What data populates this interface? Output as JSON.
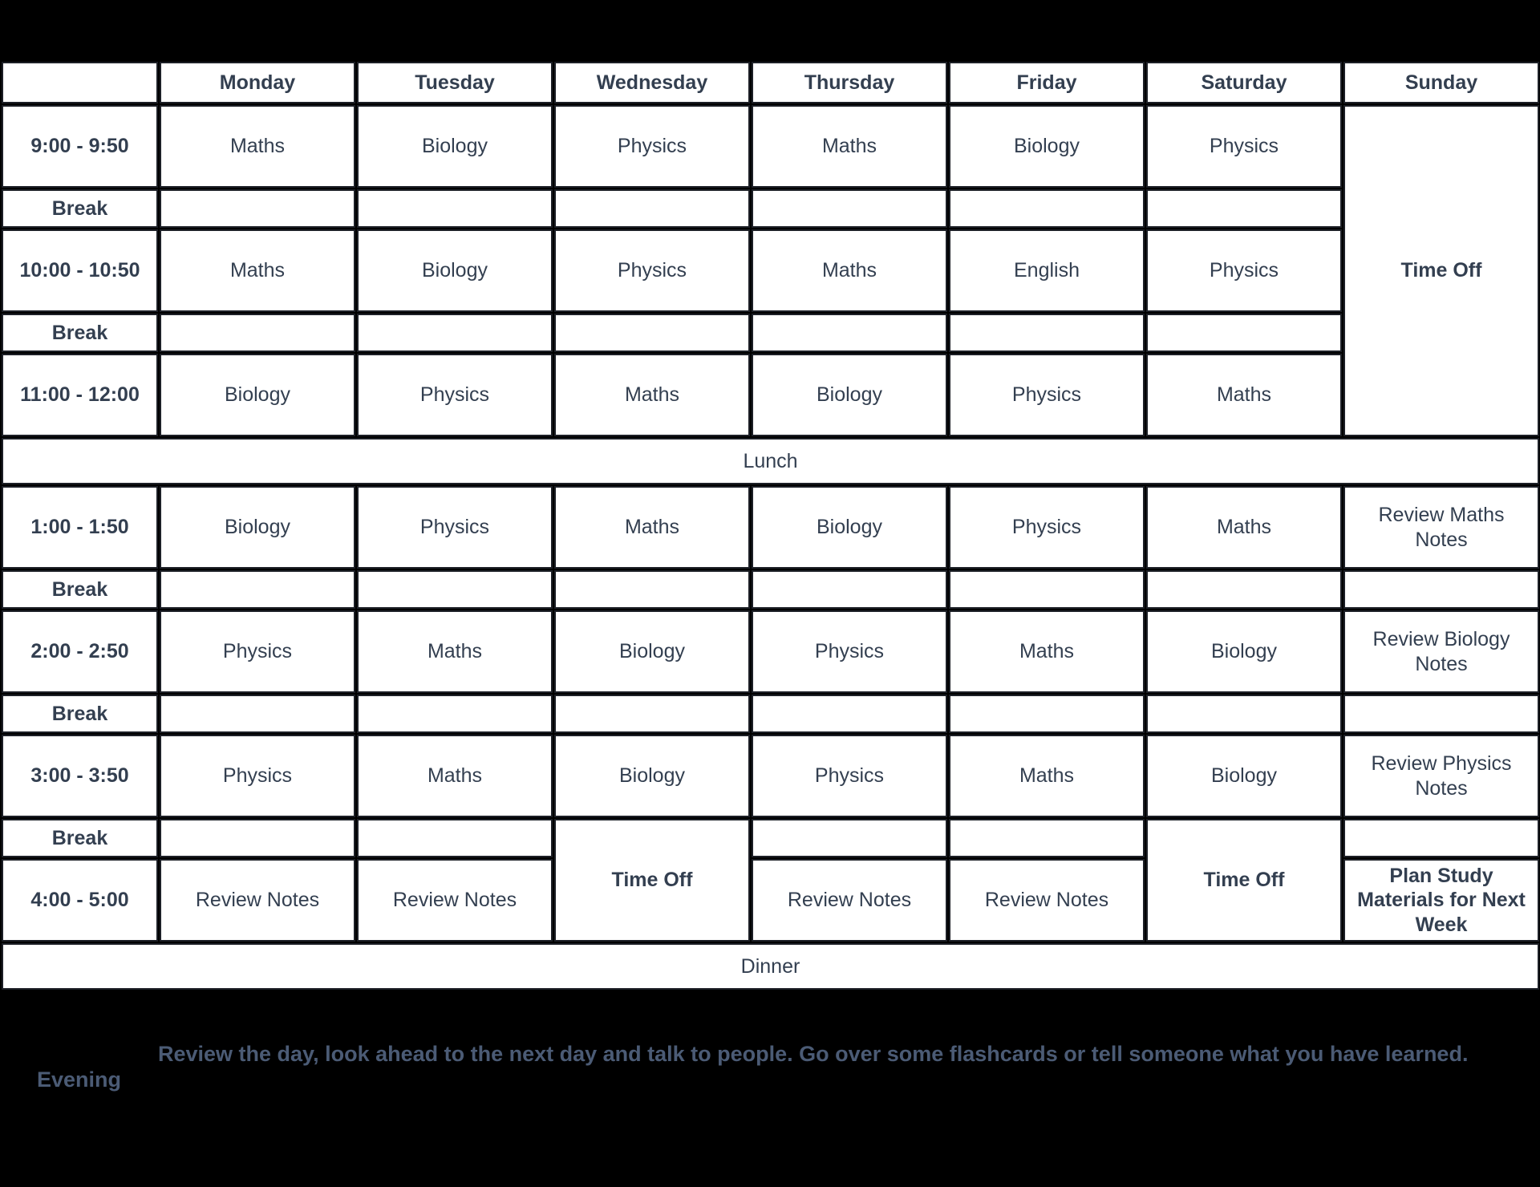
{
  "colors": {
    "maths": "#d7e4e3",
    "biology": "#5cae5c",
    "physics": "#fc9d9d",
    "english": "#5cae5c",
    "break": "#e1e1dc",
    "time_off": "#8c7c52",
    "meal_band": "#1d4e5a",
    "review_notes": "#e8b5f0",
    "review_biology": "#bba5fa",
    "plan_study": "#9cbdbb",
    "text": "#333f50",
    "page_background": "#000000",
    "evening_text": "#4b5b75"
  },
  "header": {
    "corner_label": "",
    "days": [
      "Monday",
      "Tuesday",
      "Wednesday",
      "Thursday",
      "Friday",
      "Saturday",
      "Sunday"
    ]
  },
  "labels": {
    "break": "Break",
    "lunch": "Lunch",
    "dinner": "Dinner",
    "time_off": "Time Off",
    "evening_title": "Evening",
    "evening_text": "Review the day, look ahead to the next day and talk to people. Go over some flashcards or tell someone what you have learned."
  },
  "times": {
    "slot1": "9:00 - 9:50",
    "slot2": "10:00 - 10:50",
    "slot3": "11:00 - 12:00",
    "slot4": "1:00 - 1:50",
    "slot5": "2:00 - 2:50",
    "slot6": "3:00 - 3:50",
    "slot7": "4:00 - 5:00"
  },
  "schedule": {
    "slot1": {
      "monday": "Maths",
      "tuesday": "Biology",
      "wednesday": "Physics",
      "thursday": "Maths",
      "friday": "Biology",
      "saturday": "Physics",
      "sunday": "Time Off"
    },
    "slot2": {
      "monday": "Maths",
      "tuesday": "Biology",
      "wednesday": "Physics",
      "thursday": "Maths",
      "friday": "English",
      "saturday": "Physics"
    },
    "slot3": {
      "monday": "Biology",
      "tuesday": "Physics",
      "wednesday": "Maths",
      "thursday": "Biology",
      "friday": "Physics",
      "saturday": "Maths"
    },
    "slot4": {
      "monday": "Biology",
      "tuesday": "Physics",
      "wednesday": "Maths",
      "thursday": "Biology",
      "friday": "Physics",
      "saturday": "Maths",
      "sunday": "Review Maths Notes"
    },
    "slot5": {
      "monday": "Physics",
      "tuesday": "Maths",
      "wednesday": "Biology",
      "thursday": "Physics",
      "friday": "Maths",
      "saturday": "Biology",
      "sunday": "Review Biology Notes"
    },
    "slot6": {
      "monday": "Physics",
      "tuesday": "Maths",
      "wednesday": "Biology",
      "thursday": "Physics",
      "friday": "Maths",
      "saturday": "Biology",
      "sunday": "Review Physics Notes"
    },
    "slot7": {
      "monday": "Review Notes",
      "tuesday": "Review Notes",
      "wednesday": "Time Off",
      "thursday": "Review Notes",
      "friday": "Review Notes",
      "saturday": "Time Off",
      "sunday": "Plan Study Materials for Next Week"
    }
  }
}
